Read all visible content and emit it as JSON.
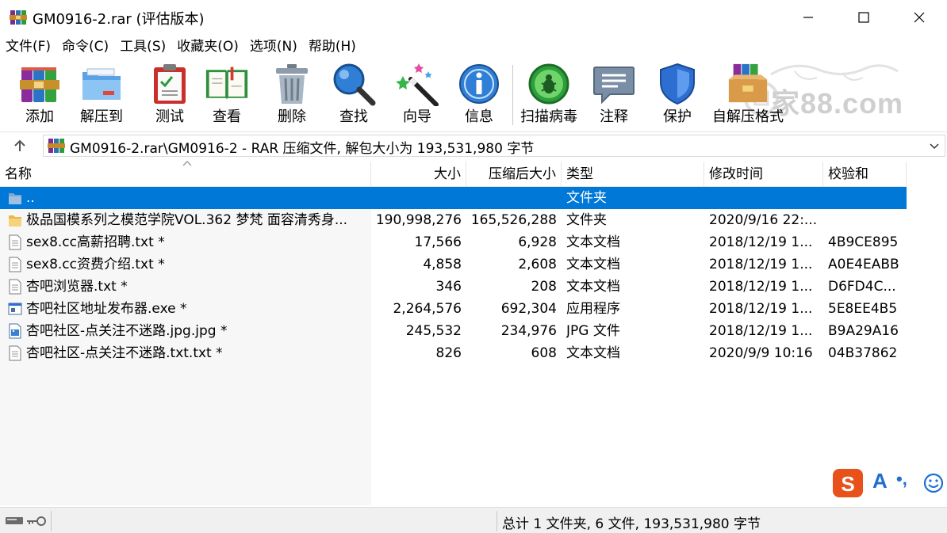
{
  "window": {
    "title": "GM0916-2.rar (评估版本)",
    "icon": "winrar-archive-icon"
  },
  "menu": [
    "文件(F)",
    "命令(C)",
    "工具(S)",
    "收藏夹(O)",
    "选项(N)",
    "帮助(H)"
  ],
  "toolbar": {
    "buttons": [
      {
        "label": "添加",
        "icon": "add-books-icon"
      },
      {
        "label": "解压到",
        "icon": "extract-folder-icon"
      },
      {
        "label": "测试",
        "icon": "test-clipboard-icon"
      },
      {
        "label": "查看",
        "icon": "view-book-icon"
      },
      {
        "label": "删除",
        "icon": "trash-icon"
      },
      {
        "label": "查找",
        "icon": "magnifier-icon"
      },
      {
        "label": "向导",
        "icon": "wizard-wand-icon"
      },
      {
        "label": "信息",
        "icon": "info-icon"
      },
      {
        "label": "扫描病毒",
        "icon": "virus-scan-icon"
      },
      {
        "label": "注释",
        "icon": "comment-icon"
      },
      {
        "label": "保护",
        "icon": "shield-icon"
      },
      {
        "label": "自解压格式",
        "icon": "sfx-box-icon"
      }
    ],
    "watermark": "家88.com"
  },
  "address": {
    "path": "GM0916-2.rar\\GM0916-2 - RAR 压缩文件, 解包大小为 193,531,980 字节"
  },
  "columns": [
    "名称",
    "大小",
    "压缩后大小",
    "类型",
    "修改时间",
    "校验和"
  ],
  "files": [
    {
      "name": "..",
      "size": "",
      "packed": "",
      "type": "文件夹",
      "modified": "",
      "crc": "",
      "icon": "folder-up-icon",
      "selected": true
    },
    {
      "name": "极品国模系列之模范学院VOL.362 梦梵 面容清秀身...",
      "size": "190,998,276",
      "packed": "165,526,288",
      "type": "文件夹",
      "modified": "2020/9/16 22:...",
      "crc": "",
      "icon": "folder-icon",
      "selected": false
    },
    {
      "name": "sex8.cc高薪招聘.txt *",
      "size": "17,566",
      "packed": "6,928",
      "type": "文本文档",
      "modified": "2018/12/19 1...",
      "crc": "4B9CE895",
      "icon": "text-file-icon",
      "selected": false
    },
    {
      "name": "sex8.cc资费介绍.txt *",
      "size": "4,858",
      "packed": "2,608",
      "type": "文本文档",
      "modified": "2018/12/19 1...",
      "crc": "A0E4EABB",
      "icon": "text-file-icon",
      "selected": false
    },
    {
      "name": "杏吧浏览器.txt *",
      "size": "346",
      "packed": "208",
      "type": "文本文档",
      "modified": "2018/12/19 1...",
      "crc": "D6FD4C...",
      "icon": "text-file-icon",
      "selected": false
    },
    {
      "name": "杏吧社区地址发布器.exe *",
      "size": "2,264,576",
      "packed": "692,304",
      "type": "应用程序",
      "modified": "2018/12/19 1...",
      "crc": "5E8EE4B5",
      "icon": "exe-file-icon",
      "selected": false
    },
    {
      "name": "杏吧社区-点关注不迷路.jpg.jpg *",
      "size": "245,532",
      "packed": "234,976",
      "type": "JPG 文件",
      "modified": "2018/12/19 1...",
      "crc": "B9A29A16",
      "icon": "image-file-icon",
      "selected": false
    },
    {
      "name": "杏吧社区-点关注不迷路.txt.txt *",
      "size": "826",
      "packed": "608",
      "type": "文本文档",
      "modified": "2020/9/9 10:16",
      "crc": "04B37862",
      "icon": "text-file-icon",
      "selected": false
    }
  ],
  "status": {
    "summary": "总计 1 文件夹, 6 文件, 193,531,980 字节"
  },
  "ime": {
    "letter": "A",
    "punct": "•,"
  },
  "colors": {
    "selection": "#0078d7",
    "ime_brand": "#e8511a"
  }
}
